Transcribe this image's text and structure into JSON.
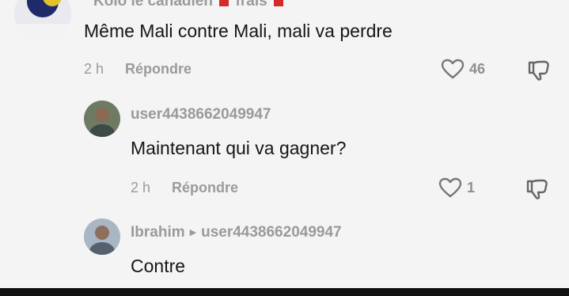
{
  "comments": [
    {
      "username": "Kolo le canadien",
      "username_suffix": "frais",
      "text": "Même Mali contre Mali, mali va perdre",
      "time": "2 h",
      "reply_label": "Répondre",
      "likes": "46"
    },
    {
      "username": "user4438662049947",
      "text": "Maintenant qui va gagner?",
      "time": "2 h",
      "reply_label": "Répondre",
      "likes": "1"
    },
    {
      "username": "Ibrahim",
      "reply_to": "user4438662049947",
      "text": "Contre"
    }
  ],
  "icons": {
    "like": "heart-outline-icon",
    "dislike": "thumbs-down-outline-icon",
    "reply_arrow": "caret-right-icon"
  },
  "colors": {
    "background": "#f4f4f4",
    "text": "#161616",
    "muted": "#9b9b9b",
    "flag": "#d32a2a"
  }
}
